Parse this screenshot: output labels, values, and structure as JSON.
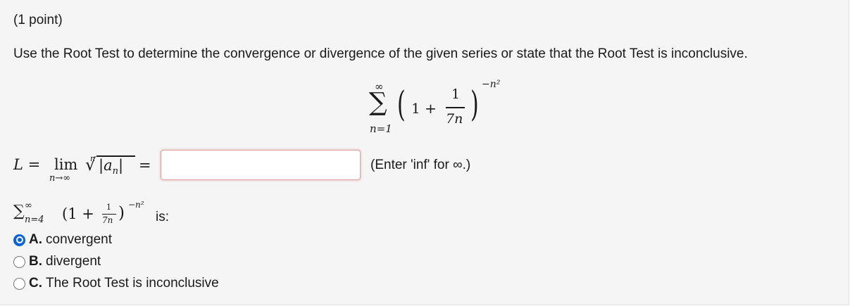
{
  "header": {
    "points": "(1 point)"
  },
  "prompt": "Use the Root Test to determine the convergence or divergence of the given series or state that the Root Test is inconclusive.",
  "display_formula": {
    "sum_symbol": "∑",
    "upper": "∞",
    "lower": "n=1",
    "one_plus": "1 +",
    "frac_num": "1",
    "frac_den": "7n",
    "exponent": "−n²"
  },
  "limit_formula": {
    "lhs": "L =",
    "lim": "lim",
    "lim_sub": "n→∞",
    "root_index": "n",
    "radicand": "|a",
    "radicand_sub": "n",
    "radicand_close": "|",
    "equals": "="
  },
  "answer_input": {
    "value": "",
    "placeholder": ""
  },
  "hint": "(Enter 'inf' for ∞.)",
  "inline_formula": {
    "sum_symbol": "∑",
    "upper": "∞",
    "lower": "n=4",
    "one_plus": "(1 +",
    "frac_num": "1",
    "frac_den": "7n",
    "close": ")",
    "exponent": "−n²",
    "suffix": "is:"
  },
  "options": [
    {
      "letter": "A.",
      "text": "convergent",
      "checked": true
    },
    {
      "letter": "B.",
      "text": "divergent",
      "checked": false
    },
    {
      "letter": "C.",
      "text": "The Root Test is inconclusive",
      "checked": false
    }
  ],
  "colors": {
    "accent": "#0a63d6",
    "input_border": "#e0a3a3",
    "background": "#f5f5f5"
  }
}
